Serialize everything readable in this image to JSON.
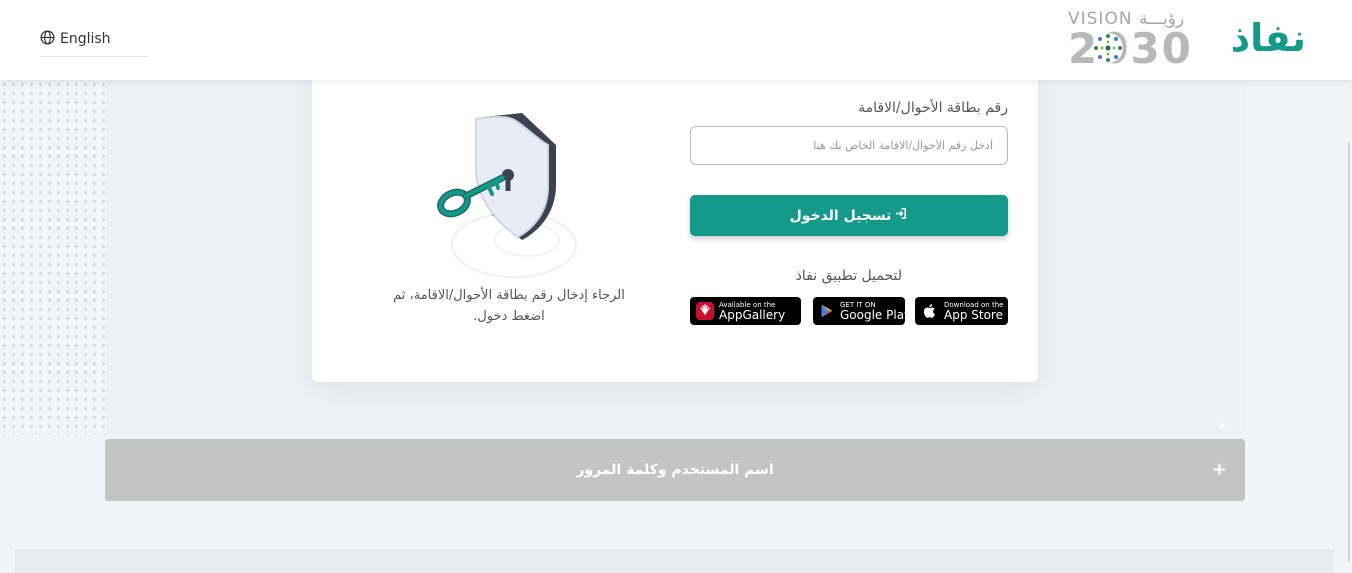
{
  "header": {
    "language_label": "English",
    "brand_logo_text": "نفاذ",
    "vision_logo_top": "VISION رؤيـــة",
    "vision_logo_year": "2030"
  },
  "login": {
    "field_label": "رقم بطاقة الأحوال/الاقامة",
    "field_placeholder": "أدخل رقم الأحوال/الاقامة الخاص بك هنا",
    "field_value": "",
    "login_button_label": "تسجيل الدخول",
    "download_label": "لتحميل تطبيق نفاذ",
    "instructions": "الرجاء إدخال رقم بطاقة الأحوال/الاقامة، ثم اضغط دخول."
  },
  "stores": {
    "appgallery": {
      "small": "Available on the",
      "big": "AppGallery"
    },
    "googleplay": {
      "small": "GET IT ON",
      "big": "Google Play"
    },
    "appstore": {
      "small": "Download on the",
      "big": "App Store"
    }
  },
  "accordion": {
    "title": "اسم المستخدم وكلمة المرور",
    "toggle_symbol": "+"
  },
  "colors": {
    "brand": "#14998b",
    "accordion": "#c4c4c4",
    "background": "#f3f4f8"
  },
  "icons": [
    "globe-icon",
    "login-arrow-icon",
    "huawei-icon",
    "google-play-icon",
    "apple-icon",
    "shield-key-illustration"
  ]
}
